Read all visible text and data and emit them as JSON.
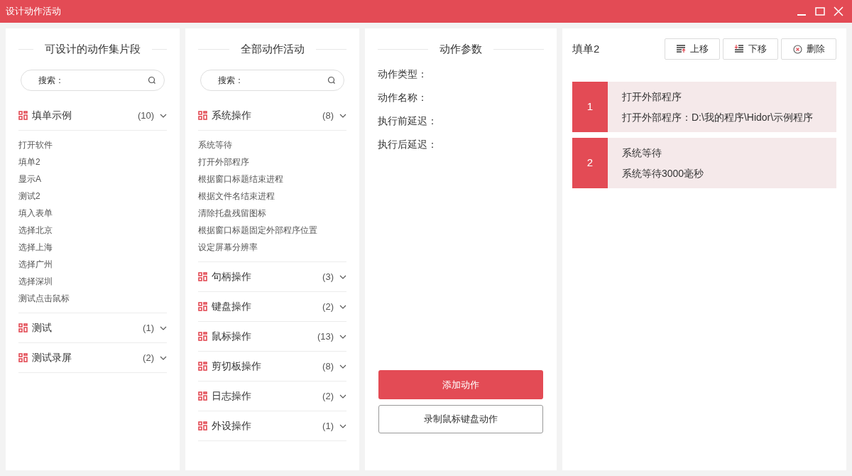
{
  "window": {
    "title": "设计动作活动"
  },
  "snippets_panel": {
    "title": "可设计的动作集片段",
    "search": {
      "placeholder": "搜索："
    },
    "groups": [
      {
        "label": "填单示例",
        "count": "(10)",
        "items": [
          "打开软件",
          "填单2",
          "显示A",
          "测试2",
          "填入表单",
          "选择北京",
          "选择上海",
          "选择广州",
          "选择深圳",
          "测试点击鼠标"
        ]
      },
      {
        "label": "测试",
        "count": "(1)"
      },
      {
        "label": "测试录屏",
        "count": "(2)"
      }
    ]
  },
  "activities_panel": {
    "title": "全部动作活动",
    "search": {
      "placeholder": "搜索："
    },
    "groups": [
      {
        "label": "系统操作",
        "count": "(8)",
        "items": [
          "系统等待",
          "打开外部程序",
          "根据窗口标题结束进程",
          "根据文件名结束进程",
          "清除托盘残留图标",
          "根据窗口标题固定外部程序位置",
          "设定屏幕分辨率"
        ]
      },
      {
        "label": "句柄操作",
        "count": "(3)"
      },
      {
        "label": "键盘操作",
        "count": "(2)"
      },
      {
        "label": "鼠标操作",
        "count": "(13)"
      },
      {
        "label": "剪切板操作",
        "count": "(8)"
      },
      {
        "label": "日志操作",
        "count": "(2)"
      },
      {
        "label": "外设操作",
        "count": "(1)"
      }
    ]
  },
  "params_panel": {
    "title": "动作参数",
    "fields": [
      "动作类型：",
      "动作名称：",
      "执行前延迟：",
      "执行后延迟："
    ],
    "buttons": [
      {
        "label": "添加动作",
        "kind": "primary"
      },
      {
        "label": "录制鼠标键盘动作",
        "kind": "secondary"
      }
    ]
  },
  "sequence_panel": {
    "title": "填单2",
    "toolbar": [
      {
        "label": "上移",
        "kind": "up"
      },
      {
        "label": "下移",
        "kind": "down"
      },
      {
        "label": "删除",
        "kind": "delete"
      }
    ],
    "steps": [
      {
        "number": "1",
        "name": "打开外部程序",
        "detail": "打开外部程序：D:\\我的程序\\Hidor\\示例程序"
      },
      {
        "number": "2",
        "name": "系统等待",
        "detail": "系统等待3000毫秒"
      }
    ]
  }
}
